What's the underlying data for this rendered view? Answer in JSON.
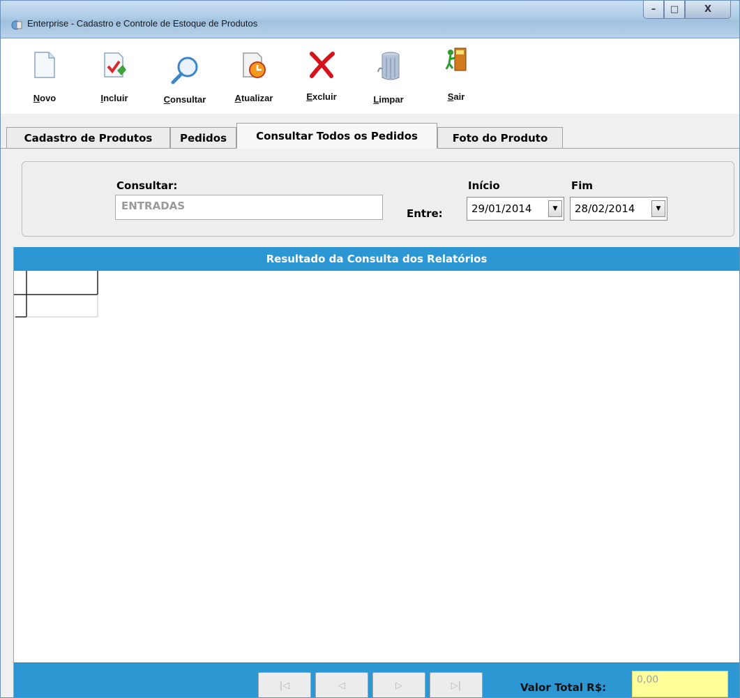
{
  "window": {
    "title": "Enterprise - Cadastro e Controle de Estoque de Produtos",
    "buttons": {
      "minimize": "–",
      "maximize": "□",
      "close": "X"
    }
  },
  "toolbar": {
    "items": [
      {
        "label": "Novo",
        "icon": "new-document-icon"
      },
      {
        "label": "Incluir",
        "icon": "add-document-icon"
      },
      {
        "label": "Consultar",
        "icon": "magnifier-icon"
      },
      {
        "label": "Atualizar",
        "icon": "update-clock-icon"
      },
      {
        "label": "Excluir",
        "icon": "delete-x-icon"
      },
      {
        "label": "Limpar",
        "icon": "trash-can-icon"
      },
      {
        "label": "Sair",
        "icon": "exit-door-icon"
      }
    ]
  },
  "tabs": {
    "items": [
      {
        "label": "Cadastro de Produtos"
      },
      {
        "label": "Pedidos"
      },
      {
        "label": "Consultar Todos os Pedidos"
      },
      {
        "label": "Foto do Produto"
      }
    ],
    "active": "Consultar Todos os Pedidos"
  },
  "filter": {
    "consultar_label": "Consultar:",
    "consultar_value": "ENTRADAS",
    "entre_label": "Entre:",
    "inicio_label": "Início",
    "inicio_value": "29/01/2014",
    "fim_label": "Fim",
    "fim_value": "28/02/2014"
  },
  "results": {
    "title": "Resultado da Consulta dos Relatórios",
    "nav": {
      "first": "|◁",
      "prev": "◁",
      "next": "▷",
      "last": "▷|"
    },
    "total_label": "Valor Total R$:",
    "total_value": "0,00"
  },
  "colors": {
    "accent_blue": "#2c97d3",
    "total_field": "#ffff99"
  }
}
